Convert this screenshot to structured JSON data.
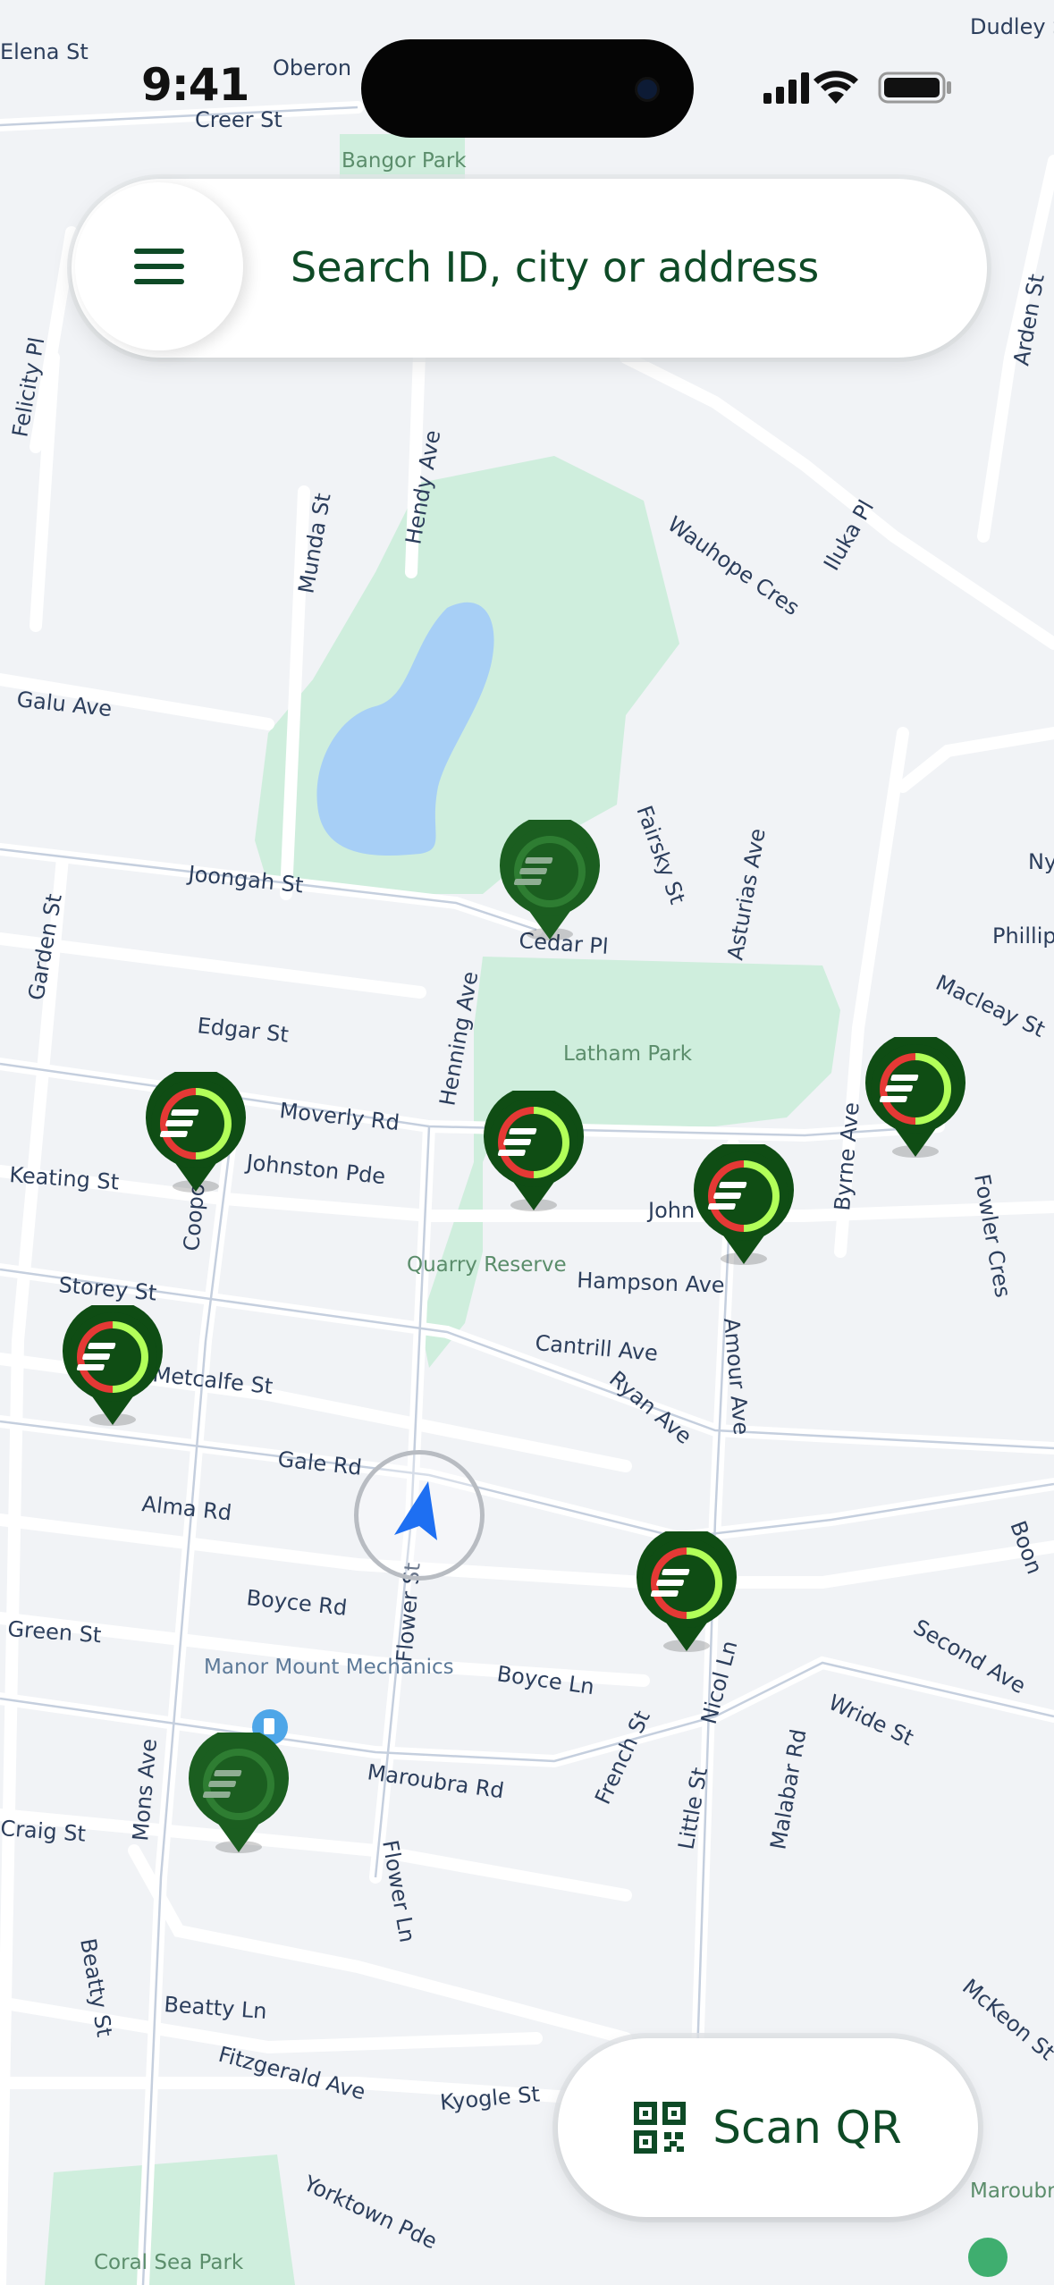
{
  "status_bar": {
    "time": "9:41"
  },
  "search": {
    "placeholder": "Search ID, city or address"
  },
  "scan_qr": {
    "label": "Scan QR"
  },
  "colors": {
    "brand_green": "#0e4a26",
    "pin_green": "#1b5e20",
    "ring_red": "#e53935",
    "ring_lime": "#b2ff59",
    "location_blue": "#1e6ff2"
  },
  "map": {
    "streets": [
      "Dudley St",
      "Elena St",
      "Oberon",
      "Creer St",
      "Felicity Pl",
      "Arden St",
      "Munda St",
      "Hendy Ave",
      "Wauhope Cres",
      "Iluka Pl",
      "Galu Ave",
      "Joongah St",
      "Fairsky St",
      "Asturias Ave",
      "Cedar Pl",
      "Garden St",
      "Edgar St",
      "Moverly Rd",
      "Henning Ave",
      "Macleay St",
      "Phillip",
      "Keating St",
      "Johnston Pde",
      "Coopo",
      "John",
      "Byrne Ave",
      "Fowler Cres",
      "Storey St",
      "Hampson Ave",
      "Metcalfe St",
      "Cantrill Ave",
      "Ryan Ave",
      "Amour Ave",
      "Gale Rd",
      "Alma Rd",
      "Boyce Rd",
      "Green St",
      "Boyce Ln",
      "Nicol Ln",
      "Malabar Rd",
      "Second Ave",
      "Maroubra Rd",
      "Wride St",
      "Mons Ave",
      "Flower St",
      "French St",
      "Little St",
      "Flower Ln",
      "Beatty St",
      "Beatty Ln",
      "Fitzgerald Ave",
      "Kyogle St",
      "Yorktown Pde",
      "McKeon St",
      "Craig St",
      "Boon",
      "Ny"
    ],
    "parks": [
      "Bangor Park",
      "Latham Park",
      "Quarry Reserve",
      "Coral Sea Park",
      "Maroubra Rockpools"
    ],
    "poi": [
      "Manor Mount Mechanics"
    ]
  },
  "chargers": [
    {
      "id": "charger-1",
      "status": "unavailable"
    },
    {
      "id": "charger-2",
      "status": "partial"
    },
    {
      "id": "charger-3",
      "status": "partial"
    },
    {
      "id": "charger-4",
      "status": "partial"
    },
    {
      "id": "charger-5",
      "status": "partial"
    },
    {
      "id": "charger-6",
      "status": "partial"
    },
    {
      "id": "charger-7",
      "status": "partial"
    },
    {
      "id": "charger-8",
      "status": "unavailable"
    }
  ]
}
